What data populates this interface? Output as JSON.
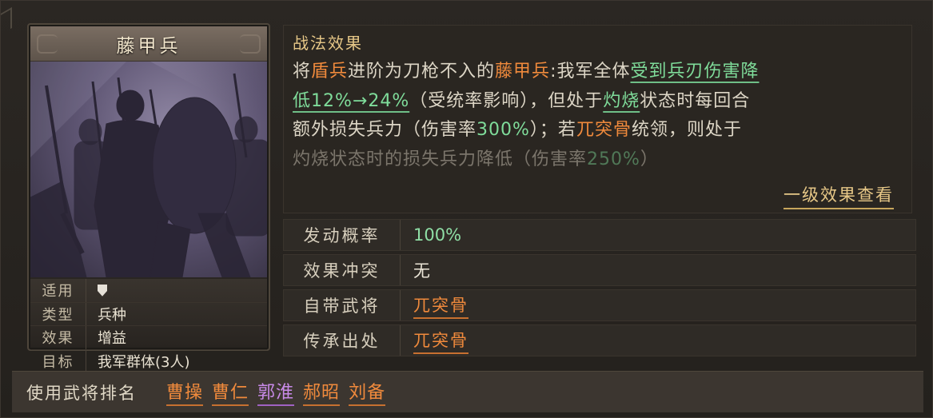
{
  "card": {
    "title": "藤甲兵",
    "props": [
      {
        "key": "适用",
        "value": "",
        "icon": "shield-icon"
      },
      {
        "key": "类型",
        "value": "兵种"
      },
      {
        "key": "效果",
        "value": "增益"
      },
      {
        "key": "目标",
        "value": "我军群体(3人)"
      }
    ]
  },
  "effect": {
    "heading": "战法效果",
    "lines": [
      [
        {
          "t": "将",
          "c": ""
        },
        {
          "t": "盾兵",
          "c": "orange"
        },
        {
          "t": "进阶为刀枪不入的",
          "c": ""
        },
        {
          "t": "藤甲兵",
          "c": "orange"
        },
        {
          "t": ":我军全体",
          "c": ""
        },
        {
          "t": "受到兵刃伤害降",
          "c": "green uline"
        }
      ],
      [
        {
          "t": "低12%→24%",
          "c": "green uline"
        },
        {
          "t": "（受统率影响），但处于",
          "c": ""
        },
        {
          "t": "灼烧",
          "c": "green uline"
        },
        {
          "t": "状态时每回合",
          "c": ""
        }
      ],
      [
        {
          "t": "额外损失兵力（伤害率",
          "c": ""
        },
        {
          "t": "300%",
          "c": "green"
        },
        {
          "t": "）；若",
          "c": ""
        },
        {
          "t": "兀突骨",
          "c": "orange"
        },
        {
          "t": "统领，则处于",
          "c": ""
        }
      ],
      [
        {
          "t": "灼烧状态时的损失兵力降低（伤害率",
          "c": ""
        },
        {
          "t": "250%",
          "c": "green"
        },
        {
          "t": "）",
          "c": ""
        }
      ]
    ],
    "level_link": "一级效果查看"
  },
  "info": [
    {
      "key": "发动概率",
      "value": "100%",
      "style": "green"
    },
    {
      "key": "效果冲突",
      "value": "无",
      "style": ""
    },
    {
      "key": "自带武将",
      "value": "兀突骨",
      "style": "link"
    },
    {
      "key": "传承出处",
      "value": "兀突骨",
      "style": "link"
    }
  ],
  "footer": {
    "label": "使用武将排名",
    "generals": [
      {
        "name": "曹操",
        "color": "orange"
      },
      {
        "name": "曹仁",
        "color": "orange"
      },
      {
        "name": "郭淮",
        "color": "purple"
      },
      {
        "name": "郝昭",
        "color": "orange"
      },
      {
        "name": "刘备",
        "color": "orange"
      }
    ]
  },
  "colors": {
    "accent_gold": "#e6c787",
    "orange": "#f08a3c",
    "green": "#7fdc9a",
    "purple": "#c88ae8"
  }
}
